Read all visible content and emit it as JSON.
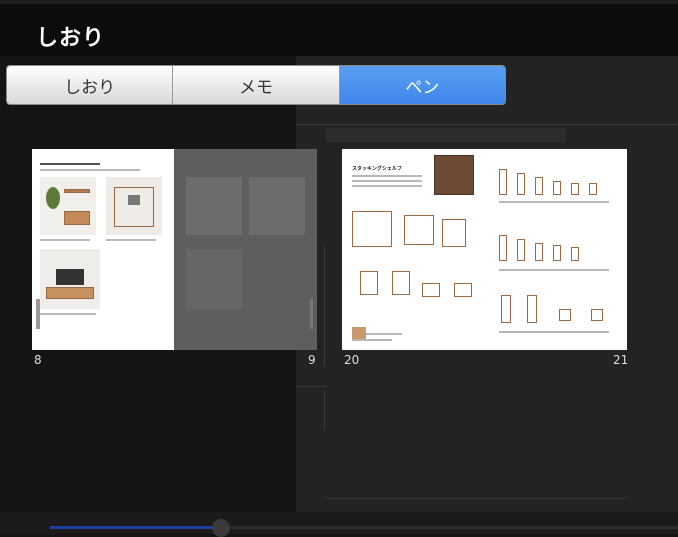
{
  "header": {
    "title": "しおり"
  },
  "tabs": [
    {
      "label": "しおり",
      "active": false
    },
    {
      "label": "メモ",
      "active": false
    },
    {
      "label": "ペン",
      "active": true
    }
  ],
  "pages": [
    {
      "number": "8"
    },
    {
      "number": "9"
    },
    {
      "number": "20"
    },
    {
      "number": "21"
    }
  ],
  "spread2": {
    "heading": "スタッキングシェルフ"
  },
  "colors": {
    "accent": "#3f86ea",
    "background": "#141414"
  }
}
